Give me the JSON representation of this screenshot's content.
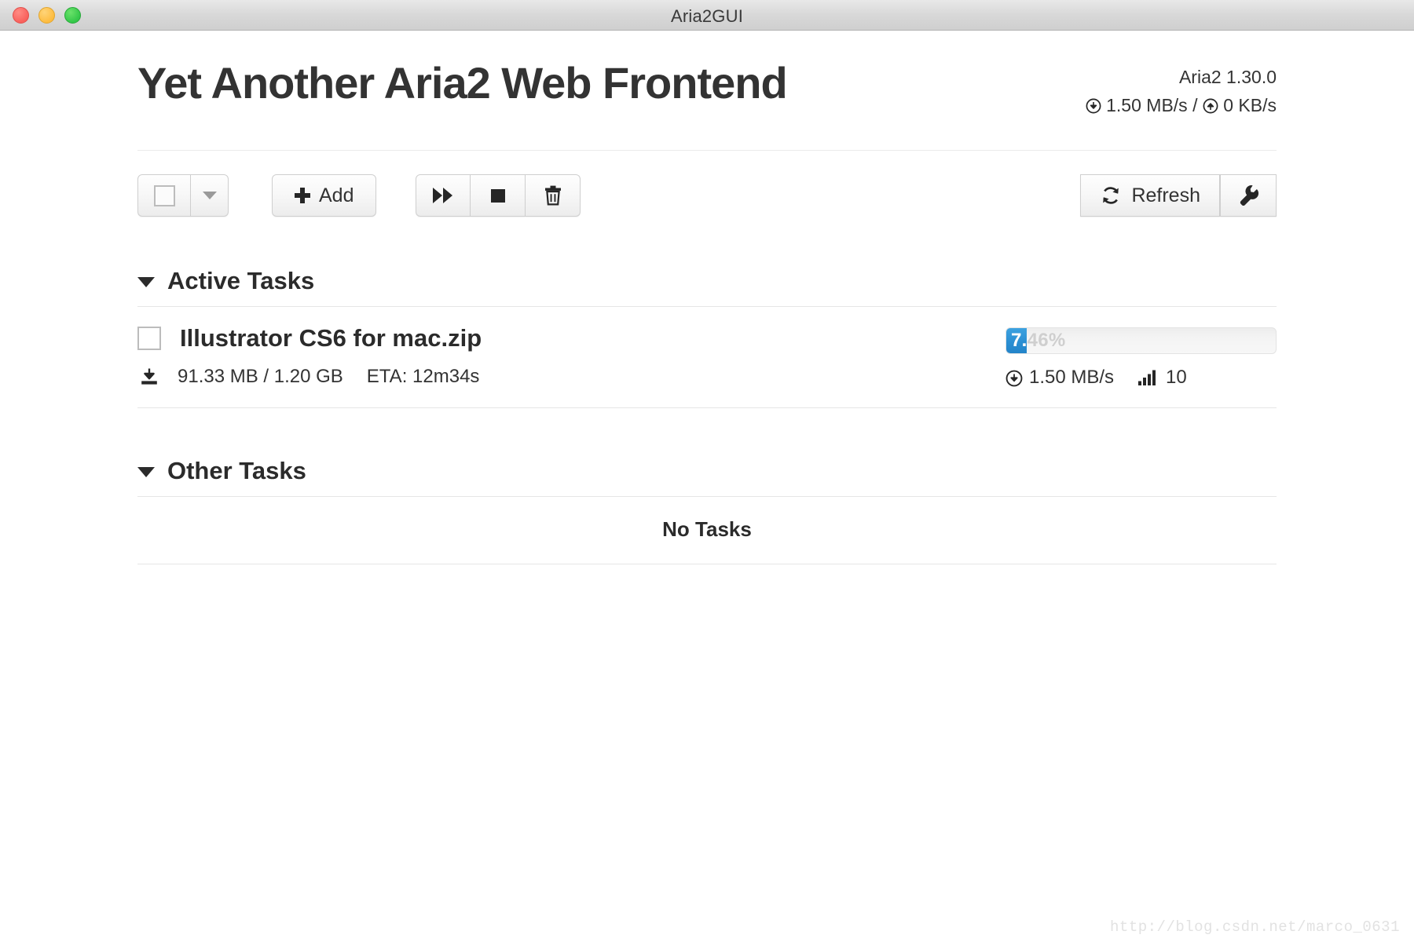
{
  "window": {
    "title": "Aria2GUI",
    "controls": [
      "close",
      "minimize",
      "zoom"
    ]
  },
  "header": {
    "app_title": "Yet Another Aria2 Web Frontend",
    "version": "Aria2 1.30.0",
    "download_speed": "1.50 MB/s",
    "speed_separator": "/",
    "upload_speed": "0 KB/s"
  },
  "toolbar": {
    "select_all_label": "",
    "select_dropdown_label": "",
    "add_label": "Add",
    "resume_label": "",
    "stop_label": "",
    "delete_label": "",
    "refresh_label": "Refresh",
    "settings_label": ""
  },
  "sections": {
    "active": {
      "title": "Active Tasks",
      "expanded": true
    },
    "other": {
      "title": "Other Tasks",
      "expanded": true,
      "empty_text": "No Tasks"
    }
  },
  "tasks": [
    {
      "name": "Illustrator CS6 for mac.zip",
      "downloaded": "91.33 MB",
      "size_separator": "/",
      "total": "1.20 GB",
      "size_text": "91.33 MB / 1.20 GB",
      "eta": "ETA: 12m34s",
      "progress_percent": 7.46,
      "progress_text": "7.46%",
      "speed": "1.50 MB/s",
      "connections": "10",
      "selected": false
    }
  ],
  "watermark": "http://blog.csdn.net/marco_0631",
  "colors": {
    "accent": "#2b8fd3",
    "text": "#333333",
    "heading": "#2b2b2b",
    "border": "#e6e6e6",
    "titlebar": "#d8d8d8"
  },
  "icons": {
    "download": "download-circle-icon",
    "upload": "upload-circle-icon",
    "save": "save-to-disk-icon",
    "connections": "signal-bars-icon",
    "refresh": "refresh-icon",
    "settings": "wrench-icon",
    "resume": "fast-forward-icon",
    "stop": "stop-square-icon",
    "delete": "trash-icon",
    "add": "plus-icon",
    "collapse": "chevron-down-icon"
  }
}
